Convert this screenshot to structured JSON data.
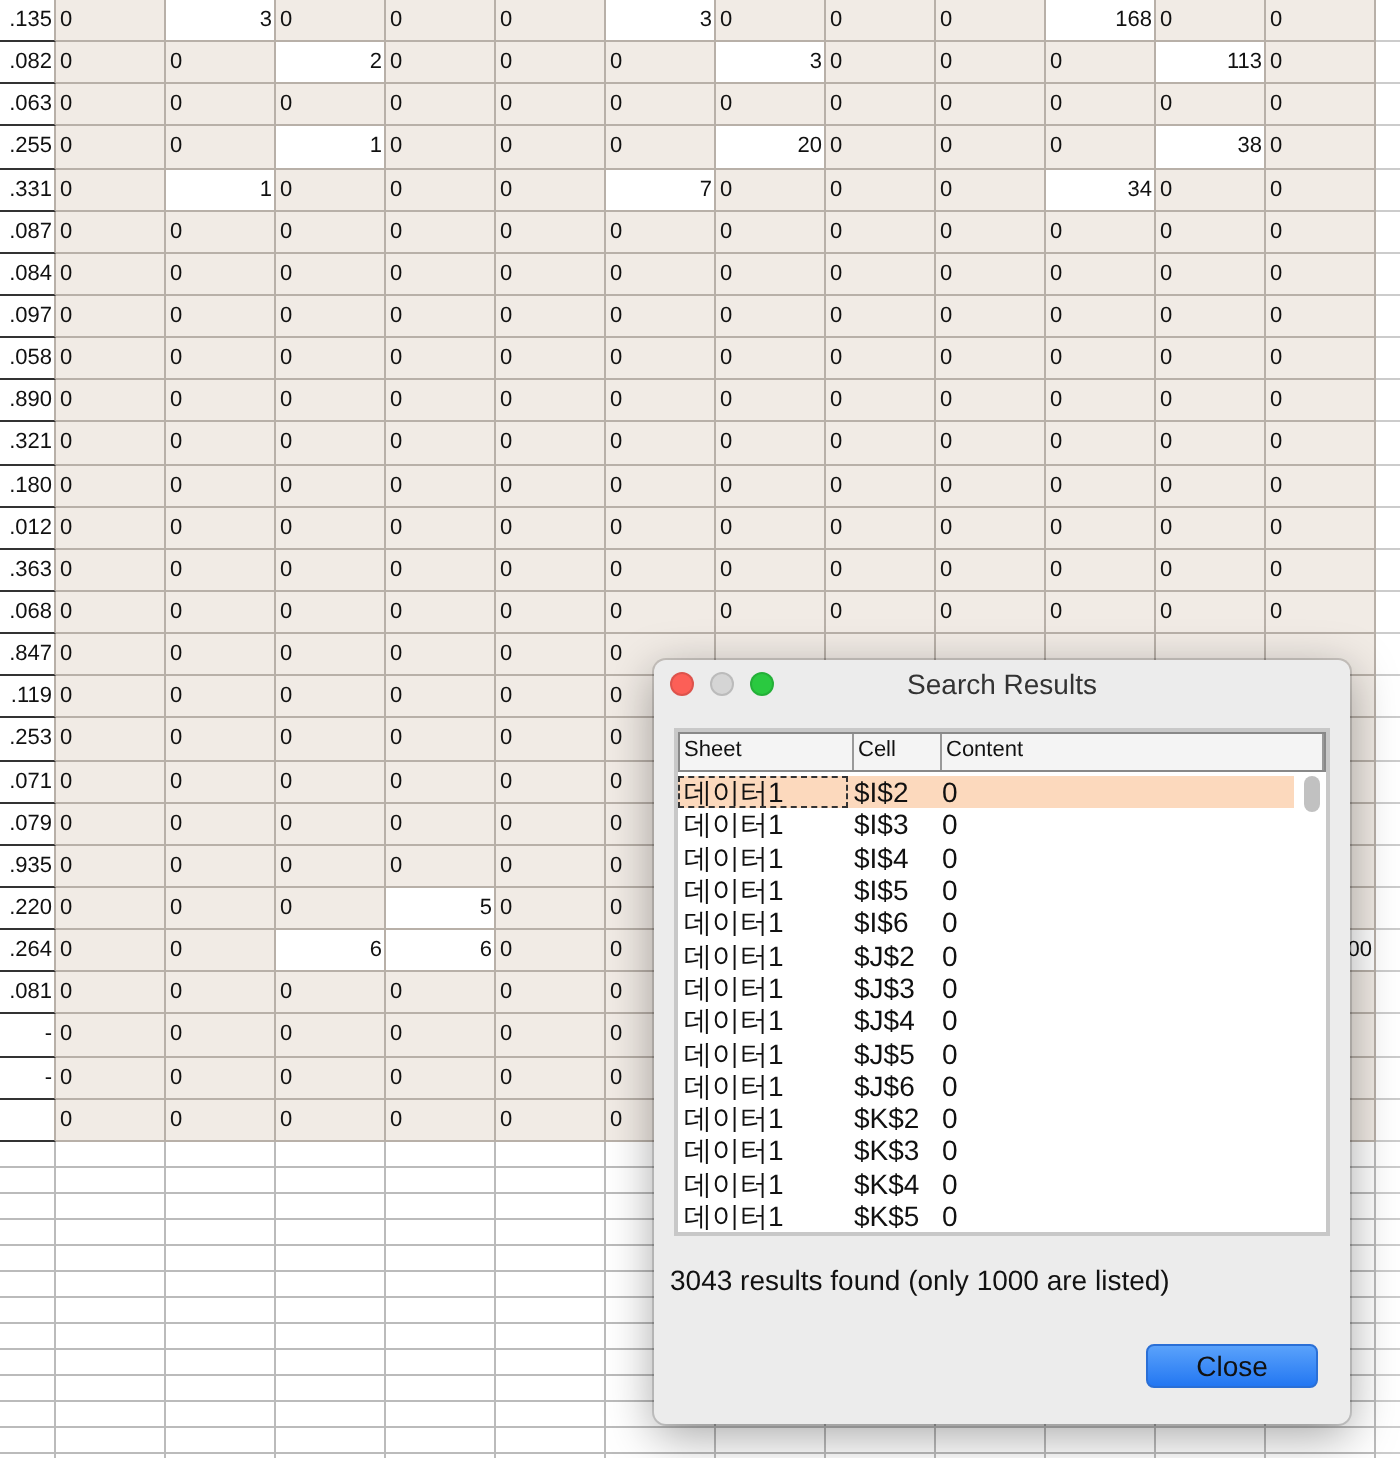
{
  "sheet": {
    "rows": [
      {
        "label": ".135",
        "cells": [
          {
            "text": "0",
            "kind": "text"
          },
          {
            "text": "3",
            "kind": "number"
          },
          {
            "text": "0",
            "kind": "text"
          },
          {
            "text": "0",
            "kind": "text"
          },
          {
            "text": "0",
            "kind": "text"
          },
          {
            "text": "3",
            "kind": "number"
          },
          {
            "text": "0",
            "kind": "text"
          },
          {
            "text": "0",
            "kind": "text"
          },
          {
            "text": "0",
            "kind": "text"
          },
          {
            "text": "168",
            "kind": "number"
          },
          {
            "text": "0",
            "kind": "text"
          },
          {
            "text": "0",
            "kind": "text"
          }
        ]
      },
      {
        "label": ".082",
        "cells": [
          {
            "text": "0",
            "kind": "text"
          },
          {
            "text": "0",
            "kind": "text"
          },
          {
            "text": "2",
            "kind": "number"
          },
          {
            "text": "0",
            "kind": "text"
          },
          {
            "text": "0",
            "kind": "text"
          },
          {
            "text": "0",
            "kind": "text"
          },
          {
            "text": "3",
            "kind": "number"
          },
          {
            "text": "0",
            "kind": "text"
          },
          {
            "text": "0",
            "kind": "text"
          },
          {
            "text": "0",
            "kind": "text"
          },
          {
            "text": "113",
            "kind": "number"
          },
          {
            "text": "0",
            "kind": "text"
          }
        ]
      },
      {
        "label": ".063",
        "cells": [
          {
            "text": "0",
            "kind": "text"
          },
          {
            "text": "0",
            "kind": "text"
          },
          {
            "text": "0",
            "kind": "text"
          },
          {
            "text": "0",
            "kind": "text"
          },
          {
            "text": "0",
            "kind": "text"
          },
          {
            "text": "0",
            "kind": "text"
          },
          {
            "text": "0",
            "kind": "text"
          },
          {
            "text": "0",
            "kind": "text"
          },
          {
            "text": "0",
            "kind": "text"
          },
          {
            "text": "0",
            "kind": "text"
          },
          {
            "text": "0",
            "kind": "text"
          },
          {
            "text": "0",
            "kind": "text"
          }
        ]
      },
      {
        "label": ".255",
        "cells": [
          {
            "text": "0",
            "kind": "text"
          },
          {
            "text": "0",
            "kind": "text"
          },
          {
            "text": "1",
            "kind": "number"
          },
          {
            "text": "0",
            "kind": "text"
          },
          {
            "text": "0",
            "kind": "text"
          },
          {
            "text": "0",
            "kind": "text"
          },
          {
            "text": "20",
            "kind": "number"
          },
          {
            "text": "0",
            "kind": "text"
          },
          {
            "text": "0",
            "kind": "text"
          },
          {
            "text": "0",
            "kind": "text"
          },
          {
            "text": "38",
            "kind": "number"
          },
          {
            "text": "0",
            "kind": "text"
          }
        ]
      },
      {
        "label": ".331",
        "cells": [
          {
            "text": "0",
            "kind": "text"
          },
          {
            "text": "1",
            "kind": "number"
          },
          {
            "text": "0",
            "kind": "text"
          },
          {
            "text": "0",
            "kind": "text"
          },
          {
            "text": "0",
            "kind": "text"
          },
          {
            "text": "7",
            "kind": "number"
          },
          {
            "text": "0",
            "kind": "text"
          },
          {
            "text": "0",
            "kind": "text"
          },
          {
            "text": "0",
            "kind": "text"
          },
          {
            "text": "34",
            "kind": "number"
          },
          {
            "text": "0",
            "kind": "text"
          },
          {
            "text": "0",
            "kind": "text"
          }
        ]
      },
      {
        "label": ".087",
        "cells": [
          {
            "text": "0",
            "kind": "text"
          },
          {
            "text": "0",
            "kind": "text"
          },
          {
            "text": "0",
            "kind": "text"
          },
          {
            "text": "0",
            "kind": "text"
          },
          {
            "text": "0",
            "kind": "text"
          },
          {
            "text": "0",
            "kind": "text"
          },
          {
            "text": "0",
            "kind": "text"
          },
          {
            "text": "0",
            "kind": "text"
          },
          {
            "text": "0",
            "kind": "text"
          },
          {
            "text": "0",
            "kind": "text"
          },
          {
            "text": "0",
            "kind": "text"
          },
          {
            "text": "0",
            "kind": "text"
          }
        ]
      },
      {
        "label": ".084",
        "cells": [
          {
            "text": "0",
            "kind": "text"
          },
          {
            "text": "0",
            "kind": "text"
          },
          {
            "text": "0",
            "kind": "text"
          },
          {
            "text": "0",
            "kind": "text"
          },
          {
            "text": "0",
            "kind": "text"
          },
          {
            "text": "0",
            "kind": "text"
          },
          {
            "text": "0",
            "kind": "text"
          },
          {
            "text": "0",
            "kind": "text"
          },
          {
            "text": "0",
            "kind": "text"
          },
          {
            "text": "0",
            "kind": "text"
          },
          {
            "text": "0",
            "kind": "text"
          },
          {
            "text": "0",
            "kind": "text"
          }
        ]
      },
      {
        "label": ".097",
        "cells": [
          {
            "text": "0",
            "kind": "text"
          },
          {
            "text": "0",
            "kind": "text"
          },
          {
            "text": "0",
            "kind": "text"
          },
          {
            "text": "0",
            "kind": "text"
          },
          {
            "text": "0",
            "kind": "text"
          },
          {
            "text": "0",
            "kind": "text"
          },
          {
            "text": "0",
            "kind": "text"
          },
          {
            "text": "0",
            "kind": "text"
          },
          {
            "text": "0",
            "kind": "text"
          },
          {
            "text": "0",
            "kind": "text"
          },
          {
            "text": "0",
            "kind": "text"
          },
          {
            "text": "0",
            "kind": "text"
          }
        ]
      },
      {
        "label": ".058",
        "cells": [
          {
            "text": "0",
            "kind": "text"
          },
          {
            "text": "0",
            "kind": "text"
          },
          {
            "text": "0",
            "kind": "text"
          },
          {
            "text": "0",
            "kind": "text"
          },
          {
            "text": "0",
            "kind": "text"
          },
          {
            "text": "0",
            "kind": "text"
          },
          {
            "text": "0",
            "kind": "text"
          },
          {
            "text": "0",
            "kind": "text"
          },
          {
            "text": "0",
            "kind": "text"
          },
          {
            "text": "0",
            "kind": "text"
          },
          {
            "text": "0",
            "kind": "text"
          },
          {
            "text": "0",
            "kind": "text"
          }
        ]
      },
      {
        "label": ".890",
        "cells": [
          {
            "text": "0",
            "kind": "text"
          },
          {
            "text": "0",
            "kind": "text"
          },
          {
            "text": "0",
            "kind": "text"
          },
          {
            "text": "0",
            "kind": "text"
          },
          {
            "text": "0",
            "kind": "text"
          },
          {
            "text": "0",
            "kind": "text"
          },
          {
            "text": "0",
            "kind": "text"
          },
          {
            "text": "0",
            "kind": "text"
          },
          {
            "text": "0",
            "kind": "text"
          },
          {
            "text": "0",
            "kind": "text"
          },
          {
            "text": "0",
            "kind": "text"
          },
          {
            "text": "0",
            "kind": "text"
          }
        ]
      },
      {
        "label": ".321",
        "cells": [
          {
            "text": "0",
            "kind": "text"
          },
          {
            "text": "0",
            "kind": "text"
          },
          {
            "text": "0",
            "kind": "text"
          },
          {
            "text": "0",
            "kind": "text"
          },
          {
            "text": "0",
            "kind": "text"
          },
          {
            "text": "0",
            "kind": "text"
          },
          {
            "text": "0",
            "kind": "text"
          },
          {
            "text": "0",
            "kind": "text"
          },
          {
            "text": "0",
            "kind": "text"
          },
          {
            "text": "0",
            "kind": "text"
          },
          {
            "text": "0",
            "kind": "text"
          },
          {
            "text": "0",
            "kind": "text"
          }
        ]
      },
      {
        "label": ".180",
        "cells": [
          {
            "text": "0",
            "kind": "text"
          },
          {
            "text": "0",
            "kind": "text"
          },
          {
            "text": "0",
            "kind": "text"
          },
          {
            "text": "0",
            "kind": "text"
          },
          {
            "text": "0",
            "kind": "text"
          },
          {
            "text": "0",
            "kind": "text"
          },
          {
            "text": "0",
            "kind": "text"
          },
          {
            "text": "0",
            "kind": "text"
          },
          {
            "text": "0",
            "kind": "text"
          },
          {
            "text": "0",
            "kind": "text"
          },
          {
            "text": "0",
            "kind": "text"
          },
          {
            "text": "0",
            "kind": "text"
          }
        ]
      },
      {
        "label": ".012",
        "cells": [
          {
            "text": "0",
            "kind": "text"
          },
          {
            "text": "0",
            "kind": "text"
          },
          {
            "text": "0",
            "kind": "text"
          },
          {
            "text": "0",
            "kind": "text"
          },
          {
            "text": "0",
            "kind": "text"
          },
          {
            "text": "0",
            "kind": "text"
          },
          {
            "text": "0",
            "kind": "text"
          },
          {
            "text": "0",
            "kind": "text"
          },
          {
            "text": "0",
            "kind": "text"
          },
          {
            "text": "0",
            "kind": "text"
          },
          {
            "text": "0",
            "kind": "text"
          },
          {
            "text": "0",
            "kind": "text"
          }
        ]
      },
      {
        "label": ".363",
        "cells": [
          {
            "text": "0",
            "kind": "text"
          },
          {
            "text": "0",
            "kind": "text"
          },
          {
            "text": "0",
            "kind": "text"
          },
          {
            "text": "0",
            "kind": "text"
          },
          {
            "text": "0",
            "kind": "text"
          },
          {
            "text": "0",
            "kind": "text"
          },
          {
            "text": "0",
            "kind": "text"
          },
          {
            "text": "0",
            "kind": "text"
          },
          {
            "text": "0",
            "kind": "text"
          },
          {
            "text": "0",
            "kind": "text"
          },
          {
            "text": "0",
            "kind": "text"
          },
          {
            "text": "0",
            "kind": "text"
          }
        ]
      },
      {
        "label": ".068",
        "cells": [
          {
            "text": "0",
            "kind": "text"
          },
          {
            "text": "0",
            "kind": "text"
          },
          {
            "text": "0",
            "kind": "text"
          },
          {
            "text": "0",
            "kind": "text"
          },
          {
            "text": "0",
            "kind": "text"
          },
          {
            "text": "0",
            "kind": "text"
          },
          {
            "text": "0",
            "kind": "text"
          },
          {
            "text": "0",
            "kind": "text"
          },
          {
            "text": "0",
            "kind": "text"
          },
          {
            "text": "0",
            "kind": "text"
          },
          {
            "text": "0",
            "kind": "text"
          },
          {
            "text": "0",
            "kind": "text"
          }
        ]
      },
      {
        "label": ".847",
        "cells": [
          {
            "text": "0",
            "kind": "text"
          },
          {
            "text": "0",
            "kind": "text"
          },
          {
            "text": "0",
            "kind": "text"
          },
          {
            "text": "0",
            "kind": "text"
          },
          {
            "text": "0",
            "kind": "text"
          },
          {
            "text": "0",
            "kind": "text"
          },
          null,
          null,
          null,
          null,
          null,
          null
        ]
      },
      {
        "label": ".119",
        "cells": [
          {
            "text": "0",
            "kind": "text"
          },
          {
            "text": "0",
            "kind": "text"
          },
          {
            "text": "0",
            "kind": "text"
          },
          {
            "text": "0",
            "kind": "text"
          },
          {
            "text": "0",
            "kind": "text"
          },
          {
            "text": "0",
            "kind": "text"
          },
          null,
          null,
          null,
          null,
          null,
          null
        ]
      },
      {
        "label": ".253",
        "cells": [
          {
            "text": "0",
            "kind": "text"
          },
          {
            "text": "0",
            "kind": "text"
          },
          {
            "text": "0",
            "kind": "text"
          },
          {
            "text": "0",
            "kind": "text"
          },
          {
            "text": "0",
            "kind": "text"
          },
          {
            "text": "0",
            "kind": "text"
          },
          null,
          null,
          null,
          null,
          null,
          null
        ]
      },
      {
        "label": ".071",
        "cells": [
          {
            "text": "0",
            "kind": "text"
          },
          {
            "text": "0",
            "kind": "text"
          },
          {
            "text": "0",
            "kind": "text"
          },
          {
            "text": "0",
            "kind": "text"
          },
          {
            "text": "0",
            "kind": "text"
          },
          {
            "text": "0",
            "kind": "text"
          },
          null,
          null,
          null,
          null,
          null,
          null
        ]
      },
      {
        "label": ".079",
        "cells": [
          {
            "text": "0",
            "kind": "text"
          },
          {
            "text": "0",
            "kind": "text"
          },
          {
            "text": "0",
            "kind": "text"
          },
          {
            "text": "0",
            "kind": "text"
          },
          {
            "text": "0",
            "kind": "text"
          },
          {
            "text": "0",
            "kind": "text"
          },
          null,
          null,
          null,
          null,
          null,
          null
        ]
      },
      {
        "label": ".935",
        "cells": [
          {
            "text": "0",
            "kind": "text"
          },
          {
            "text": "0",
            "kind": "text"
          },
          {
            "text": "0",
            "kind": "text"
          },
          {
            "text": "0",
            "kind": "text"
          },
          {
            "text": "0",
            "kind": "text"
          },
          {
            "text": "0",
            "kind": "text"
          },
          null,
          null,
          null,
          null,
          null,
          null
        ]
      },
      {
        "label": ".220",
        "cells": [
          {
            "text": "0",
            "kind": "text"
          },
          {
            "text": "0",
            "kind": "text"
          },
          {
            "text": "0",
            "kind": "text"
          },
          {
            "text": "5",
            "kind": "number"
          },
          {
            "text": "0",
            "kind": "text"
          },
          {
            "text": "0",
            "kind": "text"
          },
          null,
          null,
          null,
          null,
          null,
          null
        ]
      },
      {
        "label": ".264",
        "cells": [
          {
            "text": "0",
            "kind": "text"
          },
          {
            "text": "0",
            "kind": "text"
          },
          {
            "text": "6",
            "kind": "number"
          },
          {
            "text": "6",
            "kind": "number"
          },
          {
            "text": "0",
            "kind": "text"
          },
          {
            "text": "0",
            "kind": "text"
          },
          null,
          null,
          null,
          null,
          null,
          {
            "text": "00",
            "kind": "number"
          }
        ]
      },
      {
        "label": ".081",
        "cells": [
          {
            "text": "0",
            "kind": "text"
          },
          {
            "text": "0",
            "kind": "text"
          },
          {
            "text": "0",
            "kind": "text"
          },
          {
            "text": "0",
            "kind": "text"
          },
          {
            "text": "0",
            "kind": "text"
          },
          {
            "text": "0",
            "kind": "text"
          },
          null,
          null,
          null,
          null,
          null,
          null
        ]
      },
      {
        "label": "-",
        "cells": [
          {
            "text": "0",
            "kind": "text"
          },
          {
            "text": "0",
            "kind": "text"
          },
          {
            "text": "0",
            "kind": "text"
          },
          {
            "text": "0",
            "kind": "text"
          },
          {
            "text": "0",
            "kind": "text"
          },
          {
            "text": "0",
            "kind": "text"
          },
          null,
          null,
          null,
          null,
          null,
          null
        ]
      },
      {
        "label": "-",
        "cells": [
          {
            "text": "0",
            "kind": "text"
          },
          {
            "text": "0",
            "kind": "text"
          },
          {
            "text": "0",
            "kind": "text"
          },
          {
            "text": "0",
            "kind": "text"
          },
          {
            "text": "0",
            "kind": "text"
          },
          {
            "text": "0",
            "kind": "text"
          },
          null,
          null,
          null,
          null,
          null,
          null
        ]
      },
      {
        "label": null,
        "cells": [
          {
            "text": "0",
            "kind": "text"
          },
          {
            "text": "0",
            "kind": "text"
          },
          {
            "text": "0",
            "kind": "text"
          },
          {
            "text": "0",
            "kind": "text"
          },
          {
            "text": "0",
            "kind": "text"
          },
          {
            "text": "0",
            "kind": "text"
          },
          null,
          null,
          null,
          null,
          null,
          null
        ]
      }
    ]
  },
  "dialog": {
    "title": "Search Results",
    "columns": [
      "Sheet",
      "Cell",
      "Content"
    ],
    "results": [
      {
        "sheet": "데이터1",
        "cell": "$I$2",
        "content": "0",
        "selected": true
      },
      {
        "sheet": "데이터1",
        "cell": "$I$3",
        "content": "0",
        "selected": false
      },
      {
        "sheet": "데이터1",
        "cell": "$I$4",
        "content": "0",
        "selected": false
      },
      {
        "sheet": "데이터1",
        "cell": "$I$5",
        "content": "0",
        "selected": false
      },
      {
        "sheet": "데이터1",
        "cell": "$I$6",
        "content": "0",
        "selected": false
      },
      {
        "sheet": "데이터1",
        "cell": "$J$2",
        "content": "0",
        "selected": false
      },
      {
        "sheet": "데이터1",
        "cell": "$J$3",
        "content": "0",
        "selected": false
      },
      {
        "sheet": "데이터1",
        "cell": "$J$4",
        "content": "0",
        "selected": false
      },
      {
        "sheet": "데이터1",
        "cell": "$J$5",
        "content": "0",
        "selected": false
      },
      {
        "sheet": "데이터1",
        "cell": "$J$6",
        "content": "0",
        "selected": false
      },
      {
        "sheet": "데이터1",
        "cell": "$K$2",
        "content": "0",
        "selected": false
      },
      {
        "sheet": "데이터1",
        "cell": "$K$3",
        "content": "0",
        "selected": false
      },
      {
        "sheet": "데이터1",
        "cell": "$K$4",
        "content": "0",
        "selected": false
      },
      {
        "sheet": "데이터1",
        "cell": "$K$5",
        "content": "0",
        "selected": false
      }
    ],
    "status": "3043 results found (only 1000 are listed)",
    "button": "Close"
  }
}
